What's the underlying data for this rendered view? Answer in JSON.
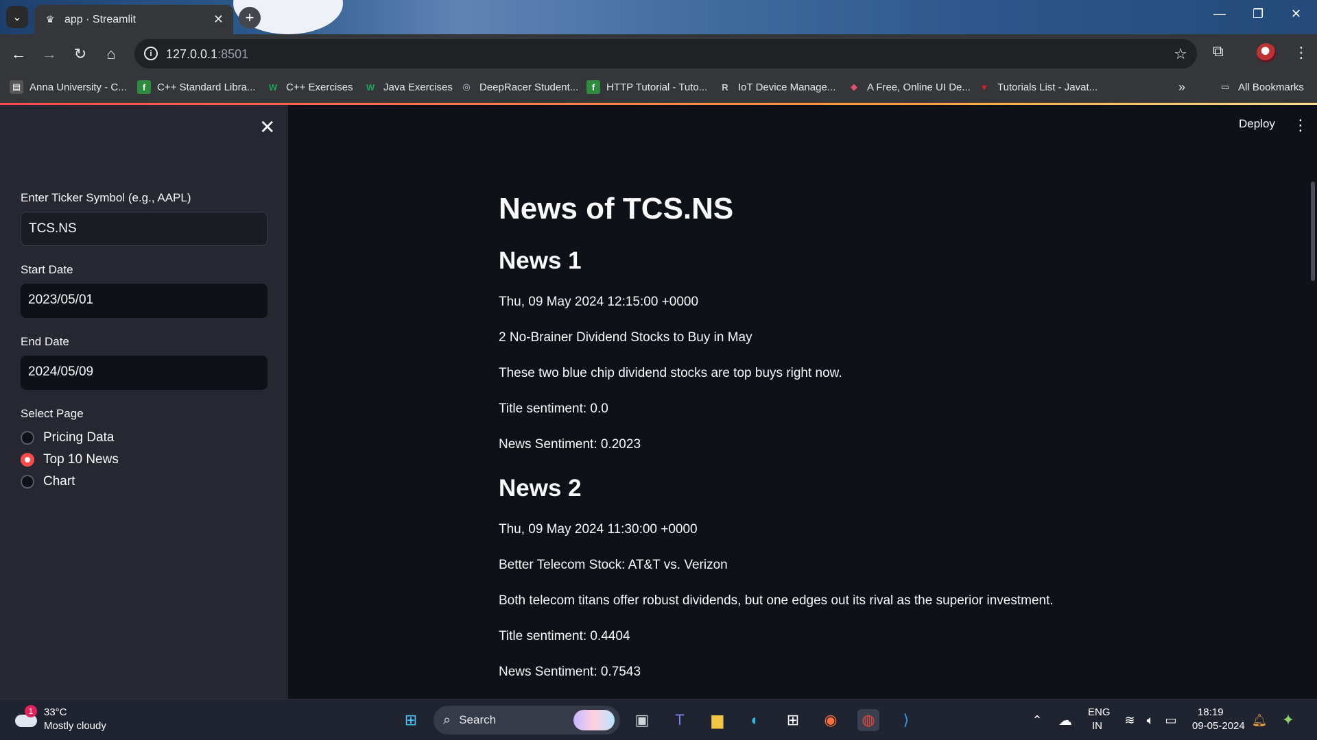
{
  "browser": {
    "tab_title": "app · Streamlit",
    "url_host": "127.0.0.1",
    "url_port": ":8501",
    "bookmarks": [
      {
        "label": "Anna University - C...",
        "color": "#555"
      },
      {
        "label": "C++ Standard Libra...",
        "color": "#2e8b3d"
      },
      {
        "label": "C++ Exercises",
        "color": "#1fa35b"
      },
      {
        "label": "Java Exercises",
        "color": "#1fa35b"
      },
      {
        "label": "DeepRacer Student...",
        "color": "#6b6b7b"
      },
      {
        "label": "HTTP Tutorial - Tuto...",
        "color": "#2e8b3d"
      },
      {
        "label": "IoT Device Manage...",
        "color": "#444"
      },
      {
        "label": "A Free, Online UI De...",
        "color": "#e2506f"
      },
      {
        "label": "Tutorials List - Javat...",
        "color": "#d42027"
      }
    ],
    "all_bookmarks": "All Bookmarks"
  },
  "sidebar": {
    "ticker_label": "Enter Ticker Symbol (e.g., AAPL)",
    "ticker_value": "TCS.NS",
    "start_label": "Start Date",
    "start_value": "2023/05/01",
    "end_label": "End Date",
    "end_value": "2024/05/09",
    "page_label": "Select Page",
    "pages": [
      {
        "label": "Pricing Data",
        "selected": false
      },
      {
        "label": "Top 10 News",
        "selected": true
      },
      {
        "label": "Chart",
        "selected": false
      }
    ]
  },
  "header": {
    "deploy": "Deploy"
  },
  "main": {
    "title": "News of TCS.NS",
    "news": [
      {
        "heading": "News 1",
        "date": "Thu, 09 May 2024 12:15:00 +0000",
        "headline": "2 No-Brainer Dividend Stocks to Buy in May",
        "summary": "These two blue chip dividend stocks are top buys right now.",
        "title_sentiment": "Title sentiment: 0.0",
        "news_sentiment": "News Sentiment: 0.2023"
      },
      {
        "heading": "News 2",
        "date": "Thu, 09 May 2024 11:30:00 +0000",
        "headline": "Better Telecom Stock: AT&T vs. Verizon",
        "summary": "Both telecom titans offer robust dividends, but one edges out its rival as the superior investment.",
        "title_sentiment": "Title sentiment: 0.4404",
        "news_sentiment": "News Sentiment: 0.7543"
      }
    ]
  },
  "taskbar": {
    "weather_badge": "1",
    "temperature": "33°C",
    "condition": "Mostly cloudy",
    "search": "Search",
    "lang1": "ENG",
    "lang2": "IN",
    "time": "18:19",
    "date": "09-05-2024"
  }
}
